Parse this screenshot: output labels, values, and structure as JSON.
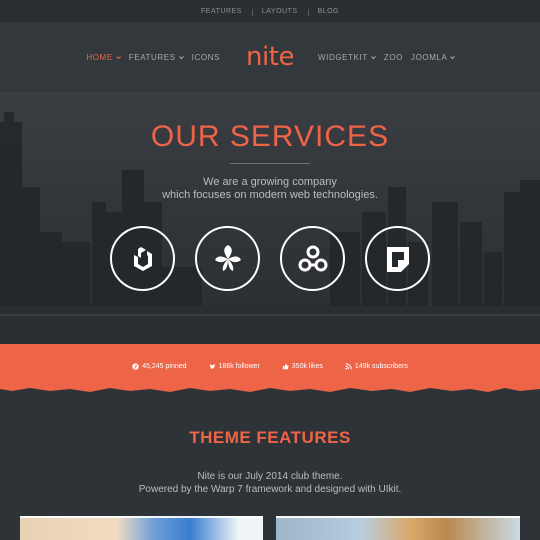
{
  "topbar": {
    "links": [
      "FEATURES",
      "LAYOUTS",
      "BLOG"
    ]
  },
  "header": {
    "logo": "nite",
    "left_nav": [
      {
        "label": "HOME",
        "dropdown": true,
        "active": true
      },
      {
        "label": "FEATURES",
        "dropdown": true,
        "active": false
      },
      {
        "label": "ICONS",
        "dropdown": false,
        "active": false
      }
    ],
    "right_nav": [
      {
        "label": "WIDGETKIT",
        "dropdown": true
      },
      {
        "label": "ZOO",
        "dropdown": false
      },
      {
        "label": "JOOMLA",
        "dropdown": true
      }
    ]
  },
  "hero": {
    "title": "OUR SERVICES",
    "subtitle_line1": "We are a growing company",
    "subtitle_line2": "which focuses on modern web technologies.",
    "services": [
      "uikit-icon",
      "leaf-icon",
      "nodes-icon",
      "page-icon"
    ]
  },
  "social": {
    "items": [
      {
        "icon": "pinterest-icon",
        "text": "45,245 pinned"
      },
      {
        "icon": "twitter-icon",
        "text": "186k follower"
      },
      {
        "icon": "like-icon",
        "text": "350k likes"
      },
      {
        "icon": "rss-icon",
        "text": "149k subscribers"
      }
    ]
  },
  "features": {
    "title": "THEME FEATURES",
    "line1": "Nite is our July 2014 club theme.",
    "line2": "Powered by the Warp 7 framework and designed with UIkit."
  },
  "colors": {
    "accent": "#ee6447",
    "background": "#2e3338",
    "header": "#33383d"
  }
}
